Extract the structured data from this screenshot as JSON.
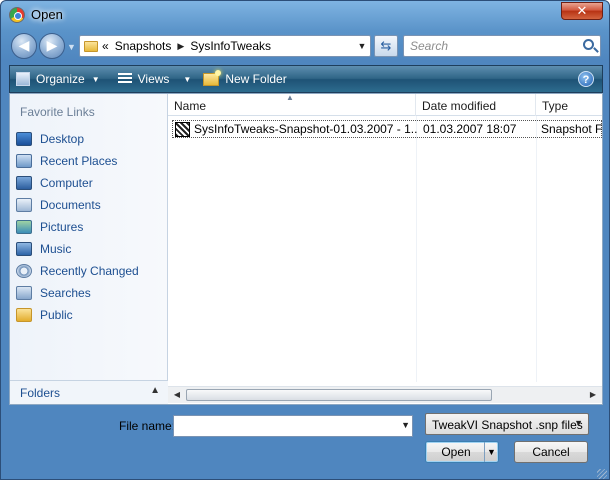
{
  "window": {
    "title": "Open",
    "close_label": "✕"
  },
  "navigation": {
    "back_glyph": "◀",
    "forward_glyph": "▶"
  },
  "address_bar": {
    "overflow_label": "«",
    "crumbs": [
      "Snapshots",
      "SysInfoTweaks"
    ]
  },
  "search": {
    "placeholder": "Search"
  },
  "toolbar": {
    "organize_label": "Organize",
    "views_label": "Views",
    "new_folder_label": "New Folder",
    "help_label": "?"
  },
  "nav_pane": {
    "header": "Favorite Links",
    "items": [
      {
        "label": "Desktop",
        "icon": "desktop-icon"
      },
      {
        "label": "Recent Places",
        "icon": "recent-places-icon"
      },
      {
        "label": "Computer",
        "icon": "computer-icon"
      },
      {
        "label": "Documents",
        "icon": "documents-icon"
      },
      {
        "label": "Pictures",
        "icon": "pictures-icon"
      },
      {
        "label": "Music",
        "icon": "music-icon"
      },
      {
        "label": "Recently Changed",
        "icon": "recently-changed-icon"
      },
      {
        "label": "Searches",
        "icon": "searches-icon"
      },
      {
        "label": "Public",
        "icon": "public-folder-icon"
      }
    ],
    "folders_label": "Folders"
  },
  "file_list": {
    "columns": [
      "Name",
      "Date modified",
      "Type"
    ],
    "rows": [
      {
        "name": "SysInfoTweaks-Snapshot-01.03.2007 - 1...",
        "date_modified": "01.03.2007 18:07",
        "type": "Snapshot Fi"
      }
    ]
  },
  "bottom": {
    "file_name_label": "File name:",
    "file_name_value": "",
    "file_type_selected": "TweakVI Snapshot .snp files",
    "open_label": "Open",
    "cancel_label": "Cancel"
  }
}
